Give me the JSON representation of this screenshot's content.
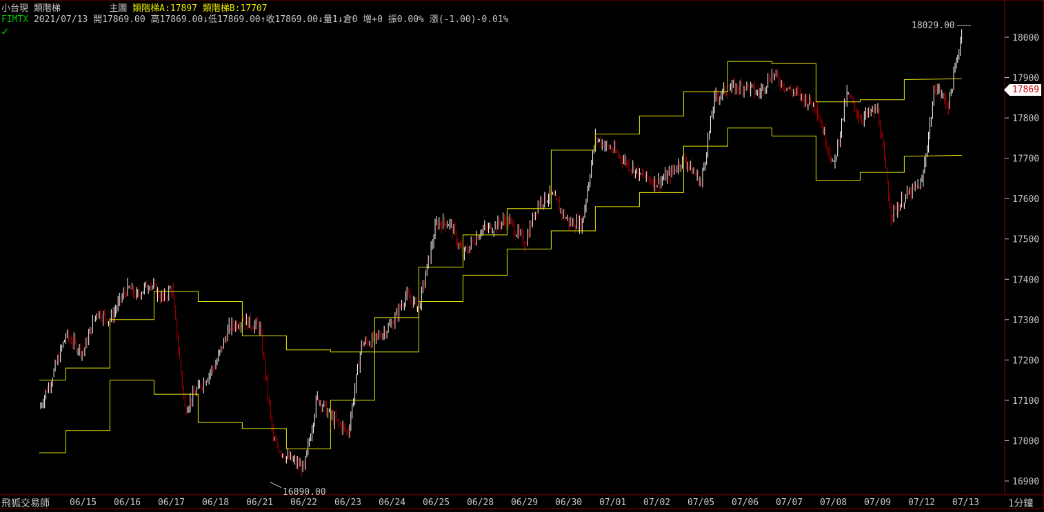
{
  "header": {
    "product": "小台現",
    "study": "類階梯",
    "panel_label": "主圖",
    "indicator_a_label": "類階梯A",
    "indicator_a_value": "17897",
    "indicator_b_label": "類階梯B",
    "indicator_b_value": "17707"
  },
  "quote": {
    "symbol": "FIMTX",
    "date": "2021/07/13",
    "open_label": "開",
    "open": "17869.00",
    "high_label": "高",
    "high": "17869.00",
    "low_label": "↓低",
    "low": "17869.00",
    "close_label": "↑收",
    "close": "17869.00",
    "volume_label": "↓量",
    "volume": "1",
    "oi_label": "↓倉",
    "oi": "0",
    "oi_change_label": "增",
    "oi_change": "+0",
    "amplitude_label": "振",
    "amplitude": "0.00%",
    "change_label": "漲",
    "change": "(-1.00)-0.01%"
  },
  "footer": {
    "brand": "飛狐交易師",
    "period": "1分鐘"
  },
  "last_price_tag": "17869",
  "colors": {
    "background": "#000000",
    "grid": "#8b0000",
    "step_lines": "#e6e600",
    "bar_up": "#ffffff",
    "bar_down": "#b40000",
    "text": "#c8c8c8"
  },
  "chart_data": {
    "type": "line",
    "title": "",
    "xlabel": "",
    "ylabel": "",
    "ylim": [
      16870,
      18060
    ],
    "y_ticks": [
      16900,
      17000,
      17100,
      17200,
      17300,
      17400,
      17500,
      17600,
      17700,
      17800,
      17900,
      18000
    ],
    "categories": [
      "06/15",
      "06/16",
      "06/17",
      "06/18",
      "06/21",
      "06/22",
      "06/23",
      "06/24",
      "06/25",
      "06/28",
      "06/29",
      "06/30",
      "07/01",
      "07/02",
      "07/05",
      "07/06",
      "07/07",
      "07/08",
      "07/09",
      "07/12",
      "07/13"
    ],
    "grid": false,
    "annotations": [
      {
        "text": "18029.00",
        "value": 18029
      },
      {
        "text": "16890.00",
        "value": 16890
      }
    ],
    "price_series": {
      "name": "",
      "x": [
        0,
        0.3,
        0.6,
        1,
        1.3,
        1.6,
        2,
        2.2,
        2.5,
        2.8,
        3,
        3.3,
        3.6,
        4,
        4.3,
        4.6,
        5,
        5.3,
        5.6,
        6,
        6.3,
        6.6,
        7,
        7.3,
        7.6,
        8,
        8.3,
        8.6,
        9,
        9.3,
        9.6,
        10,
        10.3,
        10.6,
        11,
        11.3,
        11.6,
        12,
        12.3,
        12.6,
        13,
        13.3,
        13.6,
        14,
        14.3,
        14.6,
        15,
        15.3,
        15.6,
        16,
        16.3,
        16.6,
        17,
        17.3,
        17.6,
        18,
        18.3,
        18.6,
        19,
        19.3,
        19.6,
        20,
        20.3,
        20.6,
        20.9
      ],
      "values": [
        17080,
        17160,
        17260,
        17220,
        17320,
        17300,
        17380,
        17360,
        17390,
        17350,
        17380,
        17080,
        17130,
        17190,
        17280,
        17300,
        17280,
        17000,
        16960,
        16930,
        17110,
        17060,
        17020,
        17240,
        17250,
        17290,
        17360,
        17330,
        17540,
        17540,
        17460,
        17520,
        17530,
        17550,
        17490,
        17590,
        17610,
        17540,
        17540,
        17750,
        17720,
        17690,
        17660,
        17640,
        17660,
        17700,
        17640,
        17850,
        17870,
        17880,
        17860,
        17910,
        17870,
        17850,
        17830,
        17680,
        17860,
        17800,
        17820,
        17560,
        17600,
        17640,
        17880,
        17830,
        18010,
        17900,
        17869
      ]
    },
    "series": [
      {
        "name": "",
        "x": [
          0,
          0.6,
          0.6,
          1.6,
          1.6,
          2.6,
          2.6,
          3.6,
          3.6,
          4.6,
          4.6,
          5.6,
          5.6,
          6.6,
          6.6,
          7.6,
          7.6,
          8.6,
          8.6,
          9.6,
          9.6,
          10.6,
          10.6,
          11.6,
          11.6,
          12.6,
          12.6,
          13.6,
          13.6,
          14.6,
          14.6,
          15.6,
          15.6,
          16.6,
          16.6,
          17.6,
          17.6,
          18.6,
          18.6,
          19.6,
          19.6,
          20.9
        ],
        "values": [
          17150,
          17150,
          17180,
          17180,
          17300,
          17300,
          17370,
          17370,
          17345,
          17345,
          17260,
          17260,
          17225,
          17225,
          17220,
          17220,
          17305,
          17305,
          17430,
          17430,
          17510,
          17510,
          17575,
          17575,
          17720,
          17720,
          17760,
          17760,
          17805,
          17805,
          17865,
          17865,
          17940,
          17940,
          17935,
          17935,
          17840,
          17840,
          17845,
          17845,
          17895,
          17897
        ]
      },
      {
        "name": "",
        "x": [
          0,
          0.6,
          0.6,
          1.6,
          1.6,
          2.6,
          2.6,
          3.6,
          3.6,
          4.6,
          4.6,
          5.6,
          5.6,
          6.6,
          6.6,
          7.6,
          7.6,
          8.6,
          8.6,
          9.6,
          9.6,
          10.6,
          10.6,
          11.6,
          11.6,
          12.6,
          12.6,
          13.6,
          13.6,
          14.6,
          14.6,
          15.6,
          15.6,
          16.6,
          16.6,
          17.6,
          17.6,
          18.6,
          18.6,
          19.6,
          19.6,
          20.9
        ],
        "values": [
          16970,
          16970,
          17025,
          17025,
          17150,
          17150,
          17115,
          17115,
          17045,
          17045,
          17030,
          17030,
          16980,
          16980,
          17100,
          17100,
          17220,
          17220,
          17345,
          17345,
          17410,
          17410,
          17475,
          17475,
          17520,
          17520,
          17580,
          17580,
          17615,
          17615,
          17730,
          17730,
          17775,
          17775,
          17755,
          17755,
          17645,
          17645,
          17665,
          17665,
          17705,
          17707
        ]
      }
    ]
  }
}
